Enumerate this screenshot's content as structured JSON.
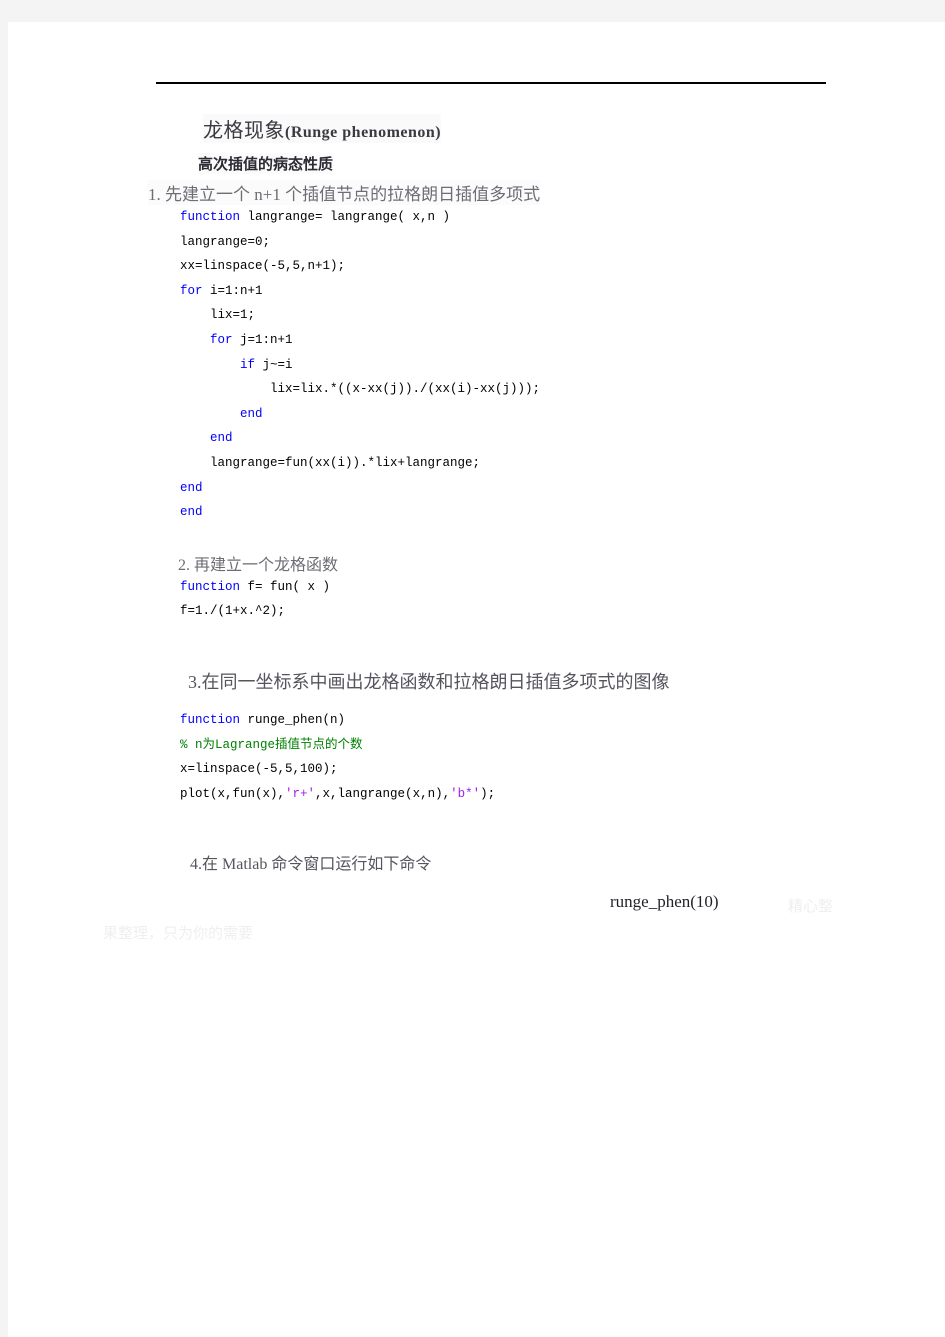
{
  "document": {
    "title_cn": "龙格现象",
    "title_latin": "(Runge  phenomenon)",
    "subtitle": "高次插值的病态性质",
    "steps": {
      "one": "1.  先建立一个 n+1 个插值节点的拉格朗日插值多项式",
      "two": "2.  再建立一个龙格函数",
      "three": "3.在同一坐标系中画出龙格函数和拉格朗日插值多项式的图像",
      "four": "4.在 Matlab 命令窗口运行如下命令"
    },
    "command": "runge_phen(10)",
    "watermark": {
      "right": "精心整",
      "bottom": "果整理，只为你的需要"
    }
  },
  "code_blocks": {
    "lagrange": [
      [
        {
          "t": "function",
          "c": "kw"
        },
        {
          "t": " langrange= langrange( x,n )",
          "c": ""
        }
      ],
      [
        {
          "t": "langrange=0;",
          "c": ""
        }
      ],
      [
        {
          "t": "xx=linspace(-5,5,n+1);",
          "c": ""
        }
      ],
      [
        {
          "t": "for",
          "c": "kw"
        },
        {
          "t": " i=1:n+1",
          "c": ""
        }
      ],
      [
        {
          "t": "    lix=1;",
          "c": ""
        }
      ],
      [
        {
          "t": "    ",
          "c": ""
        },
        {
          "t": "for",
          "c": "kw"
        },
        {
          "t": " j=1:n+1",
          "c": ""
        }
      ],
      [
        {
          "t": "        ",
          "c": ""
        },
        {
          "t": "if",
          "c": "kw"
        },
        {
          "t": " j~=i",
          "c": ""
        }
      ],
      [
        {
          "t": "            lix=lix.*((x-xx(j))./(xx(i)-xx(j)));",
          "c": ""
        }
      ],
      [
        {
          "t": "        ",
          "c": ""
        },
        {
          "t": "end",
          "c": "kw"
        }
      ],
      [
        {
          "t": "    ",
          "c": ""
        },
        {
          "t": "end",
          "c": "kw"
        }
      ],
      [
        {
          "t": "    langrange=fun(xx(i)).*lix+langrange;",
          "c": ""
        }
      ],
      [
        {
          "t": "end",
          "c": "kw"
        }
      ],
      [
        {
          "t": "end",
          "c": "kw"
        }
      ]
    ],
    "runge_fun": [
      [
        {
          "t": "function",
          "c": "kw"
        },
        {
          "t": " f= fun( x )",
          "c": ""
        }
      ],
      [
        {
          "t": "f=1./(1+x.^2);",
          "c": ""
        }
      ]
    ],
    "plot_fun": [
      [
        {
          "t": "function",
          "c": "kw"
        },
        {
          "t": " runge_phen(n)",
          "c": ""
        }
      ],
      [
        {
          "t": "% n为Lagrange插值节点的个数",
          "c": "cm"
        }
      ],
      [
        {
          "t": "x=linspace(-5,5,100);",
          "c": ""
        }
      ],
      [
        {
          "t": "plot(x,fun(x),",
          "c": ""
        },
        {
          "t": "'r+'",
          "c": "st"
        },
        {
          "t": ",x,langrange(x,n),",
          "c": ""
        },
        {
          "t": "'b*'",
          "c": "st"
        },
        {
          "t": ");",
          "c": ""
        }
      ]
    ]
  },
  "colors": {
    "keyword": "#0000ff",
    "comment": "#008000",
    "string": "#a020f0",
    "page_bg": "#ffffff",
    "frame_bg": "#f4f4f4"
  }
}
